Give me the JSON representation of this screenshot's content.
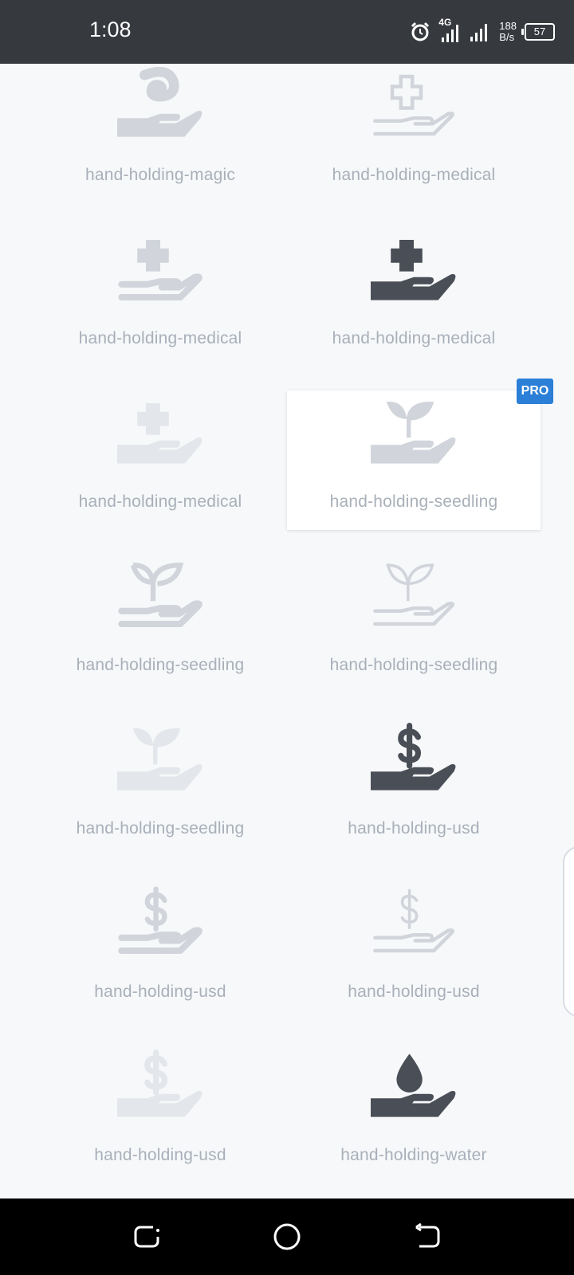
{
  "status": {
    "time": "1:08",
    "network": "4G",
    "speed_value": "188",
    "speed_unit": "B/s",
    "battery": "57"
  },
  "badge": "PRO",
  "colors": {
    "dark": "#4a4f57",
    "mid": "#d1d5db",
    "light": "#e3e6ea",
    "label": "#a9b0b9",
    "accent": "#2b7fd7"
  },
  "icons": [
    {
      "label": "hand-holding-magic",
      "glyph": "magic",
      "style": "solid",
      "tone": "mid"
    },
    {
      "label": "hand-holding-medical",
      "glyph": "medical",
      "style": "light",
      "tone": "mid"
    },
    {
      "label": "hand-holding-medical",
      "glyph": "medical",
      "style": "regular",
      "tone": "mid"
    },
    {
      "label": "hand-holding-medical",
      "glyph": "medical",
      "style": "solid",
      "tone": "dark"
    },
    {
      "label": "hand-holding-medical",
      "glyph": "medical",
      "style": "solid",
      "tone": "light"
    },
    {
      "label": "hand-holding-seedling",
      "glyph": "seedling",
      "style": "solid",
      "tone": "mid"
    },
    {
      "label": "hand-holding-seedling",
      "glyph": "seedling",
      "style": "regular",
      "tone": "mid"
    },
    {
      "label": "hand-holding-seedling",
      "glyph": "seedling",
      "style": "light",
      "tone": "mid"
    },
    {
      "label": "hand-holding-seedling",
      "glyph": "seedling",
      "style": "solid",
      "tone": "light"
    },
    {
      "label": "hand-holding-usd",
      "glyph": "usd",
      "style": "solid",
      "tone": "dark"
    },
    {
      "label": "hand-holding-usd",
      "glyph": "usd",
      "style": "regular",
      "tone": "mid"
    },
    {
      "label": "hand-holding-usd",
      "glyph": "usd",
      "style": "light",
      "tone": "mid"
    },
    {
      "label": "hand-holding-usd",
      "glyph": "usd",
      "style": "solid",
      "tone": "light"
    },
    {
      "label": "hand-holding-water",
      "glyph": "water",
      "style": "solid",
      "tone": "dark"
    }
  ]
}
